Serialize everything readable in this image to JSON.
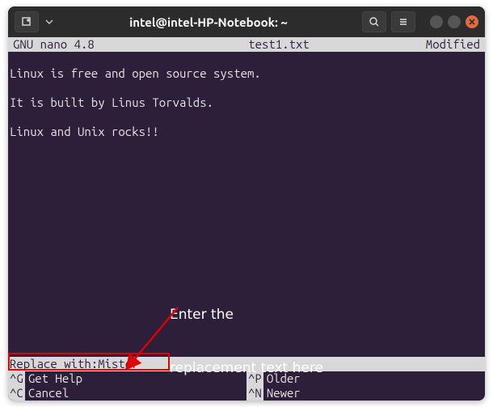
{
  "titlebar": {
    "title": "intel@intel-HP-Notebook: ~"
  },
  "nano": {
    "version": "GNU nano 4.8",
    "filename": "test1.txt",
    "status": "Modified"
  },
  "content": {
    "line1": "Linux is free and open source system.",
    "line2": "",
    "line3": "It is built by Linus Torvalds.",
    "line4": "",
    "line5": "Linux and Unix rocks!!"
  },
  "prompt": {
    "label": "Replace with: ",
    "value": "Mister"
  },
  "shortcuts": {
    "r1c1key": "^G",
    "r1c1label": "Get Help",
    "r1c2key": "^P",
    "r1c2label": "Older",
    "r2c1key": "^C",
    "r2c1label": "Cancel",
    "r2c2key": "^N",
    "r2c2label": "Newer"
  },
  "annotation": {
    "line1": "Enter the",
    "line2": "replacement text here"
  }
}
